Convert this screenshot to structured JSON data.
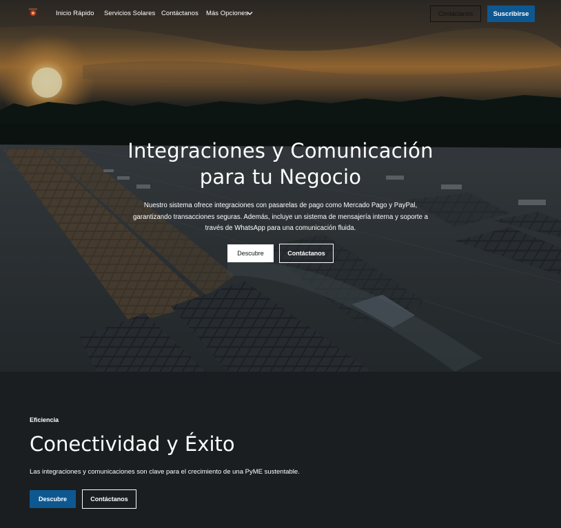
{
  "nav": {
    "links": [
      {
        "label": "Inicio Rápido"
      },
      {
        "label": "Servicios Solares"
      },
      {
        "label": "Contáctanos"
      },
      {
        "label": "Más Opciones"
      }
    ],
    "contact_button": "Contáctanos",
    "subscribe_button": "Suscribirse"
  },
  "hero": {
    "title_line1": "Integraciones y Comunicación",
    "title_line2": "para tu Negocio",
    "description": "Nuestro sistema ofrece integraciones con pasarelas de pago como Mercado Pago y PayPal, garantizando transacciones seguras. Además, incluye un sistema de mensajería interna y soporte a través de WhatsApp para una comunicación fluida.",
    "primary_button": "Descubre",
    "secondary_button": "Contáctanos"
  },
  "section": {
    "eyebrow": "Eficiencia",
    "title": "Conectividad y Éxito",
    "description": "Las integraciones y comunicaciones son clave para el crecimiento de una PyME sustentable.",
    "primary_button": "Descubre",
    "secondary_button": "Contáctanos"
  },
  "colors": {
    "accent": "#0e5891",
    "dark_section": "#1a1e20",
    "white": "#ffffff"
  },
  "icons": {
    "logo": "logo-icon",
    "dropdown": "chevron-down-icon"
  }
}
